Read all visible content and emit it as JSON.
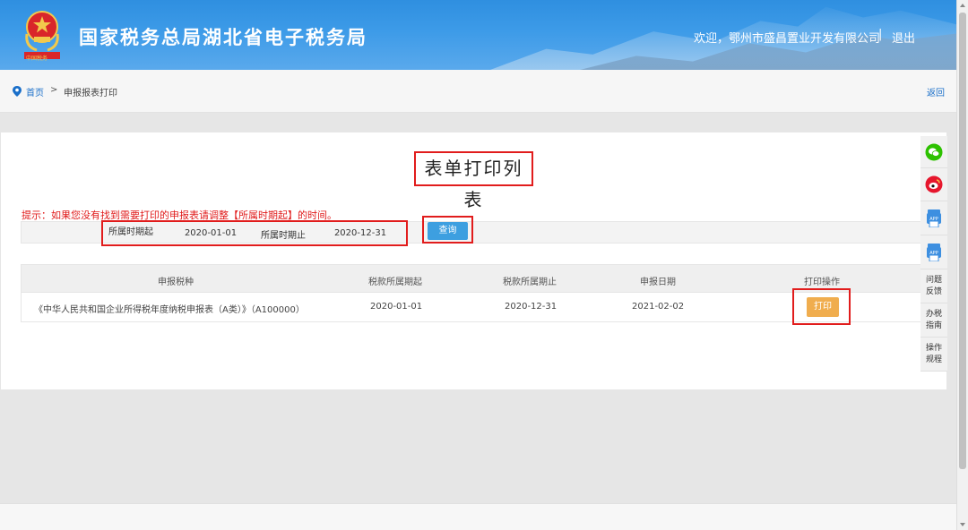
{
  "header": {
    "title": "国家税务总局湖北省电子税务局",
    "welcome": "欢迎，鄂州市盛昌置业开发有限公司",
    "separator": "|",
    "logout": "退出",
    "emblem_caption": "中国税务",
    "brand_color": "#3d9be8"
  },
  "breadcrumb": {
    "home": "首页",
    "separator": ">",
    "current": "申报报表打印",
    "back": "返回"
  },
  "main": {
    "title": "表单打印列表",
    "hint": "提示：如果您没有找到需要打印的申报表请调整【所属时期起】的时间。",
    "filter": {
      "start_label": "所属时期起",
      "start_value": "2020-01-01",
      "end_label": "所属时期止",
      "end_value": "2020-12-31",
      "query_button": "查询"
    },
    "table": {
      "headers": [
        "申报税种",
        "税款所属期起",
        "税款所属期止",
        "申报日期",
        "打印操作"
      ],
      "rows": [
        {
          "tax_type": "《中华人民共和国企业所得税年度纳税申报表（A类）》（A100000）",
          "period_start": "2020-01-01",
          "period_end": "2020-12-31",
          "filing_date": "2021-02-02",
          "action": "打印"
        }
      ]
    }
  },
  "sidebar": {
    "items": [
      {
        "icon": "wechat-icon",
        "color": "#2dc100"
      },
      {
        "icon": "weibo-icon",
        "color": "#e6162d"
      },
      {
        "icon": "app-icon",
        "label": "APP",
        "color": "#3d8fe0"
      },
      {
        "icon": "app-icon",
        "label": "APP",
        "color": "#3d8fe0"
      },
      {
        "label": "问题反馈"
      },
      {
        "label": "办税指南"
      },
      {
        "label": "操作规程"
      }
    ]
  },
  "colors": {
    "highlight_red": "#e11c1c",
    "query_blue": "#3d9fe0",
    "print_orange": "#f0ad4e",
    "hint_red": "#e01b1b"
  }
}
